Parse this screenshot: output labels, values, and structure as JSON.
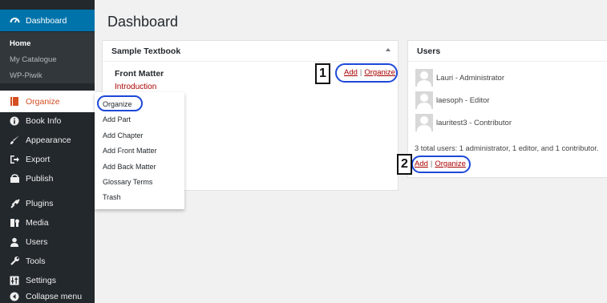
{
  "page": {
    "title": "Dashboard"
  },
  "sidebar": {
    "dashboard": {
      "label": "Dashboard"
    },
    "dashboard_submenu": [
      {
        "label": "Home"
      },
      {
        "label": "My Catalogue"
      },
      {
        "label": "WP-Piwik"
      }
    ],
    "items": [
      {
        "label": "Organize",
        "icon": "book-icon"
      },
      {
        "label": "Book Info",
        "icon": "info-icon"
      },
      {
        "label": "Appearance",
        "icon": "paintbrush-icon"
      },
      {
        "label": "Export",
        "icon": "export-icon"
      },
      {
        "label": "Publish",
        "icon": "cart-icon"
      },
      {
        "label": "Plugins",
        "icon": "plugin-icon"
      },
      {
        "label": "Media",
        "icon": "media-icon"
      },
      {
        "label": "Users",
        "icon": "users-icon"
      },
      {
        "label": "Tools",
        "icon": "wrench-icon"
      },
      {
        "label": "Settings",
        "icon": "settings-icon"
      },
      {
        "label": "Collapse menu",
        "icon": "collapse-icon"
      }
    ]
  },
  "flyout": {
    "items": [
      {
        "label": "Organize"
      },
      {
        "label": "Add Part"
      },
      {
        "label": "Add Chapter"
      },
      {
        "label": "Add Front Matter"
      },
      {
        "label": "Add Back Matter"
      },
      {
        "label": "Glossary Terms"
      },
      {
        "label": "Trash"
      }
    ]
  },
  "textbook_panel": {
    "title": "Sample Textbook",
    "front_matter": "Front Matter",
    "introduction": "Introduction",
    "add_label": "Add",
    "separator": "|",
    "organize_label": "Organize",
    "callout": "1"
  },
  "users_panel": {
    "title": "Users",
    "users": [
      {
        "name": "Lauri - Administrator"
      },
      {
        "name": "laesoph - Editor"
      },
      {
        "name": "lauritest3 - Contributor"
      }
    ],
    "summary": "3 total users: 1 administrator, 1 editor, and 1 contributor.",
    "add_label": "Add",
    "separator": "|",
    "organize_label": "Organize",
    "callout": "2"
  },
  "colors": {
    "sidebar_bg": "#23282d",
    "accent_blue": "#0073aa",
    "link_red": "#aa0000",
    "annotation_blue": "#1d49d9"
  }
}
